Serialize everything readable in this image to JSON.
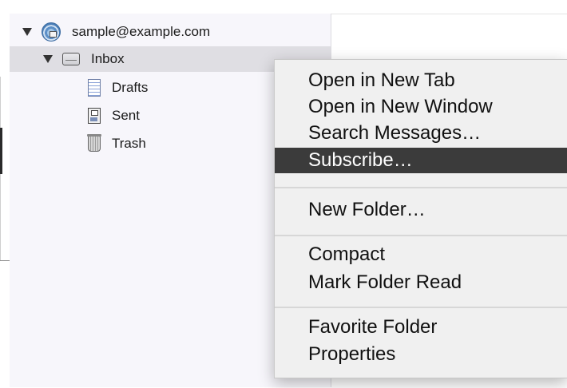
{
  "folders": {
    "account": "sample@example.com",
    "inbox": "Inbox",
    "drafts": "Drafts",
    "sent": "Sent",
    "trash": "Trash"
  },
  "context_menu": {
    "items": [
      "Open in New Tab",
      "Open in New Window",
      "Search Messages…",
      "Subscribe…",
      "New Folder…",
      "Compact",
      "Mark Folder Read",
      "Favorite Folder",
      "Properties"
    ],
    "highlighted": "Subscribe…"
  },
  "icons": {
    "account": "account-globe-icon",
    "inbox": "inbox-tray-icon",
    "drafts": "drafts-document-icon",
    "sent": "sent-floppy-icon",
    "trash": "trash-can-icon"
  },
  "colors": {
    "pane_background": "#f7f6fb",
    "selection": "#dfdee3",
    "menu_background": "#f0f0f0",
    "menu_highlight": "#3b3b3b"
  }
}
